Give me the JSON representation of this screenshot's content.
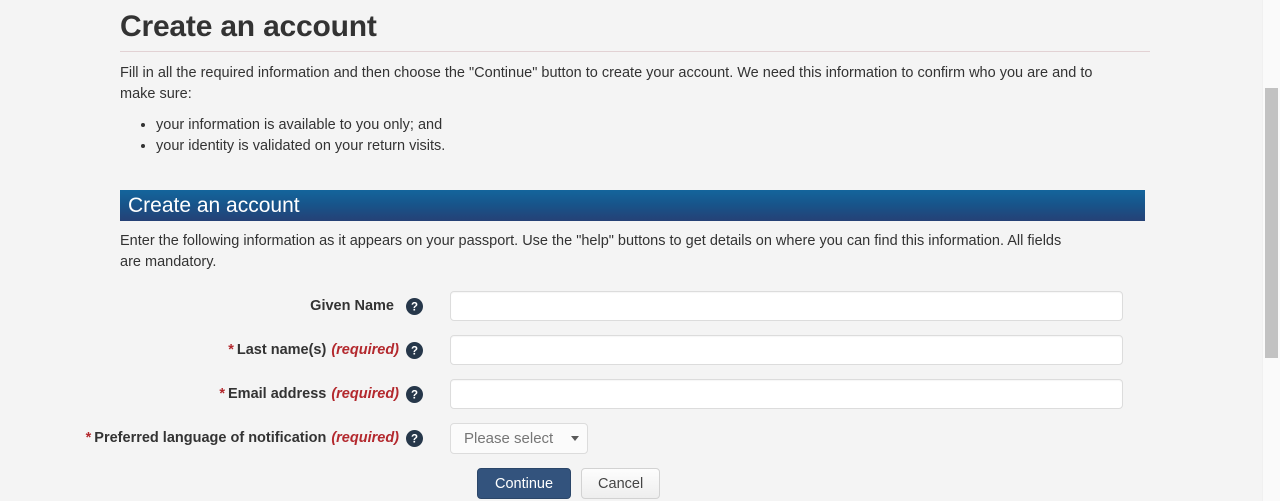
{
  "page": {
    "title": "Create an account",
    "intro": "Fill in all the required information and then choose the \"Continue\" button to create your account. We need this information to confirm who you are and to make sure:",
    "bullets": [
      "your information is available to you only; and",
      "your identity is validated on your return visits."
    ]
  },
  "panel": {
    "banner_title": "Create an account",
    "note": "Enter the following information as it appears on your passport. Use the \"help\" buttons to get details on where you can find this information. All fields are mandatory."
  },
  "form": {
    "fields": [
      {
        "label": "Given Name",
        "required_marker": "",
        "required_tag": "",
        "help_icon": "help-question-icon",
        "type": "text",
        "value": "",
        "placeholder": ""
      },
      {
        "label": "Last name(s)",
        "required_marker": "*",
        "required_tag": "(required)",
        "help_icon": "help-question-icon",
        "type": "text",
        "value": "",
        "placeholder": ""
      },
      {
        "label": "Email address",
        "required_marker": "*",
        "required_tag": "(required)",
        "help_icon": "help-question-icon",
        "type": "text",
        "value": "",
        "placeholder": ""
      },
      {
        "label": "Preferred language of notification",
        "required_marker": "*",
        "required_tag": "(required)",
        "help_icon": "help-question-icon",
        "type": "select",
        "value": "Please select",
        "placeholder": ""
      }
    ],
    "buttons": {
      "submit_label": "Continue",
      "cancel_label": "Cancel"
    }
  },
  "colors": {
    "accent_blue_top": "#14659c",
    "accent_blue_bottom": "#254176",
    "required_red": "#b3282d",
    "primary_button": "#33537d",
    "page_background": "#f4f4f4",
    "help_icon_navy": "#26374a"
  },
  "scrollbar": {
    "thumb_color": "#c2c2c2",
    "track_color": "#fafafa"
  }
}
